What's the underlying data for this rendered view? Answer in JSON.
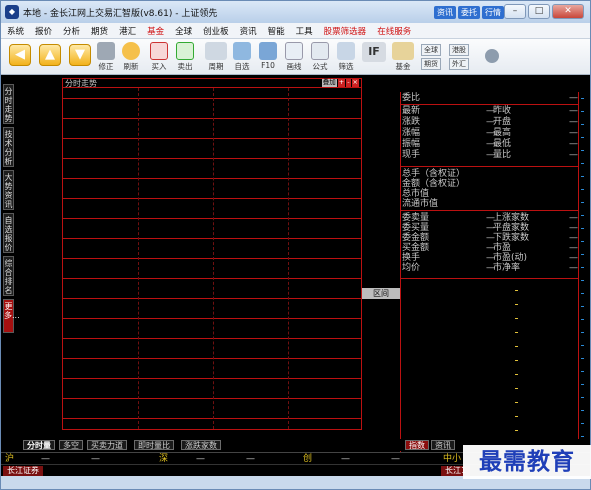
{
  "window": {
    "icon": "app-logo-icon",
    "title": "本地 - 金长江网上交易汇智版(v8.61) - 上证领先",
    "title_links": [
      "资讯",
      "委托",
      "行情"
    ],
    "controls": [
      "–",
      "□",
      "✕"
    ]
  },
  "menu": [
    "系统",
    "报价",
    "分析",
    "期货",
    "港汇",
    "基金",
    "全球",
    "创业板",
    "资讯",
    "智能",
    "工具",
    "股票筛选器",
    "在线服务"
  ],
  "menu_red": [
    "基金",
    "股票筛选器",
    "在线服务"
  ],
  "toolbar": {
    "items": [
      {
        "name": "back-arrow-button",
        "label": ""
      },
      {
        "name": "up-arrow-button",
        "label": ""
      },
      {
        "name": "down-arrow-button",
        "label": ""
      },
      {
        "name": "fix-button",
        "label": "修正"
      },
      {
        "name": "clock-button",
        "label": "刷新"
      },
      {
        "name": "buy-button",
        "label": "买入"
      },
      {
        "name": "sell-button",
        "label": "卖出"
      },
      {
        "name": "period-button",
        "label": "周期"
      },
      {
        "name": "watchlist-button",
        "label": "自选"
      },
      {
        "name": "f10-button",
        "label": "F10"
      },
      {
        "name": "drawline-button",
        "label": "画线"
      },
      {
        "name": "formula-button",
        "label": "公式"
      },
      {
        "name": "filter-button",
        "label": "筛选"
      },
      {
        "name": "fund-button",
        "label": "基金"
      }
    ],
    "small_buttons": [
      "全球",
      "港股",
      "期货",
      "外汇"
    ],
    "if_label": "IF"
  },
  "sidebar": {
    "tabs": [
      "分时走势",
      "技术分析",
      "大势资讯",
      "自选报价",
      "综合排名"
    ],
    "more": "更多..."
  },
  "chart": {
    "title": "分时走势",
    "buttons": [
      "叠加",
      "+",
      "-",
      "×"
    ]
  },
  "interval_button": "区间",
  "quote": {
    "top": {
      "label": "委比",
      "value": "—"
    },
    "rows_a": [
      {
        "l1": "最新",
        "v1": "—",
        "l2": "昨收",
        "v2": "—"
      },
      {
        "l1": "涨跌",
        "v1": "—",
        "l2": "开盘",
        "v2": "—"
      },
      {
        "l1": "涨幅",
        "v1": "—",
        "l2": "最高",
        "v2": "—"
      },
      {
        "l1": "振幅",
        "v1": "—",
        "l2": "最低",
        "v2": "—"
      },
      {
        "l1": "现手",
        "v1": "—",
        "l2": "量比",
        "v2": "—"
      }
    ],
    "rows_b": [
      {
        "l1": "总手（含权证）",
        "v1": ""
      },
      {
        "l1": "金额（含权证）",
        "v1": ""
      },
      {
        "l1": "总市值",
        "v1": ""
      },
      {
        "l1": "流通市值",
        "v1": ""
      }
    ],
    "rows_c": [
      {
        "l1": "委卖量",
        "v1": "—",
        "l2": "上涨家数",
        "v2": "—"
      },
      {
        "l1": "委买量",
        "v1": "—",
        "l2": "平盘家数",
        "v2": "—"
      },
      {
        "l1": "委金额",
        "v1": "—",
        "l2": "下跌家数",
        "v2": "—"
      },
      {
        "l1": "买金额",
        "v1": "—",
        "l2": "市盈",
        "v2": "—"
      },
      {
        "l1": "换手",
        "v1": "—",
        "l2": "市盈(动)",
        "v2": "—"
      },
      {
        "l1": "均价",
        "v1": "—",
        "l2": "市净率",
        "v2": "—"
      }
    ]
  },
  "bottom_tabs": [
    "分时量",
    "多空",
    "买卖力道",
    "即时量比",
    "涨跌家数"
  ],
  "bottom_right_tabs": [
    "指数",
    "资讯"
  ],
  "index_bar": [
    {
      "label": "沪",
      "color": "yellow"
    },
    {
      "label": "—",
      "color": "white"
    },
    {
      "label": "—",
      "color": "white"
    },
    {
      "label": "深",
      "color": "yellow"
    },
    {
      "label": "—",
      "color": "white"
    },
    {
      "label": "—",
      "color": "white"
    },
    {
      "label": "创",
      "color": "yellow"
    },
    {
      "label": "—",
      "color": "white"
    },
    {
      "label": "—",
      "color": "white"
    },
    {
      "label": "中小",
      "color": "yellow"
    }
  ],
  "status": {
    "left": "长江证券",
    "right": "长江1"
  },
  "watermark": "最需教育",
  "colors": {
    "background": "#000000",
    "grid": "#bb1111",
    "text": "#c8c8c8",
    "accent_red": "#d01010",
    "accent_blue": "#1f3fb8"
  }
}
